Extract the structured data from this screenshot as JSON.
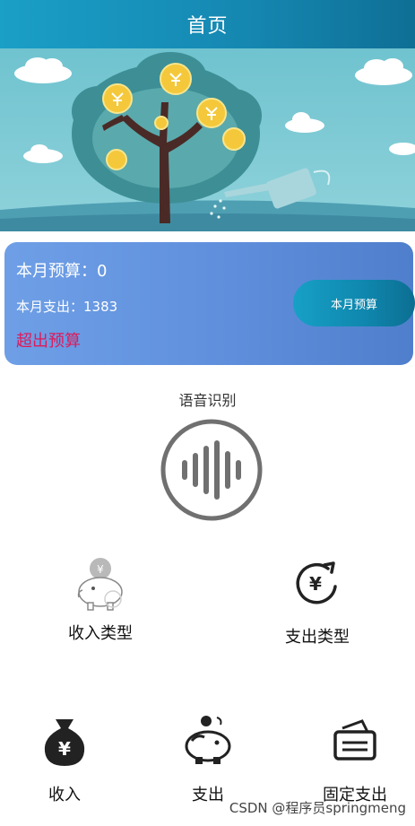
{
  "header": {
    "title": "首页"
  },
  "banner": {
    "image_name": "money-tree-illustration"
  },
  "budget": {
    "budget_text": "本月预算：0",
    "expense_text": "本月支出：1383",
    "over_text": "超出预算",
    "button_label": "本月预算",
    "over_color": "#e0195a"
  },
  "voice": {
    "label": "语音识别",
    "icon": "voice-wave-icon"
  },
  "grid": {
    "income_type": {
      "label": "收入类型",
      "icon": "piggy-bank-icon"
    },
    "expense_type": {
      "label": "支出类型",
      "icon": "yuan-refresh-icon"
    },
    "income": {
      "label": "收入",
      "icon": "money-bag-icon"
    },
    "expense": {
      "label": "支出",
      "icon": "piggy-coin-icon"
    },
    "fixed_expense": {
      "label": "固定支出",
      "icon": "wallet-icon"
    }
  },
  "watermark": {
    "text": "CSDN @程序员springmeng"
  }
}
